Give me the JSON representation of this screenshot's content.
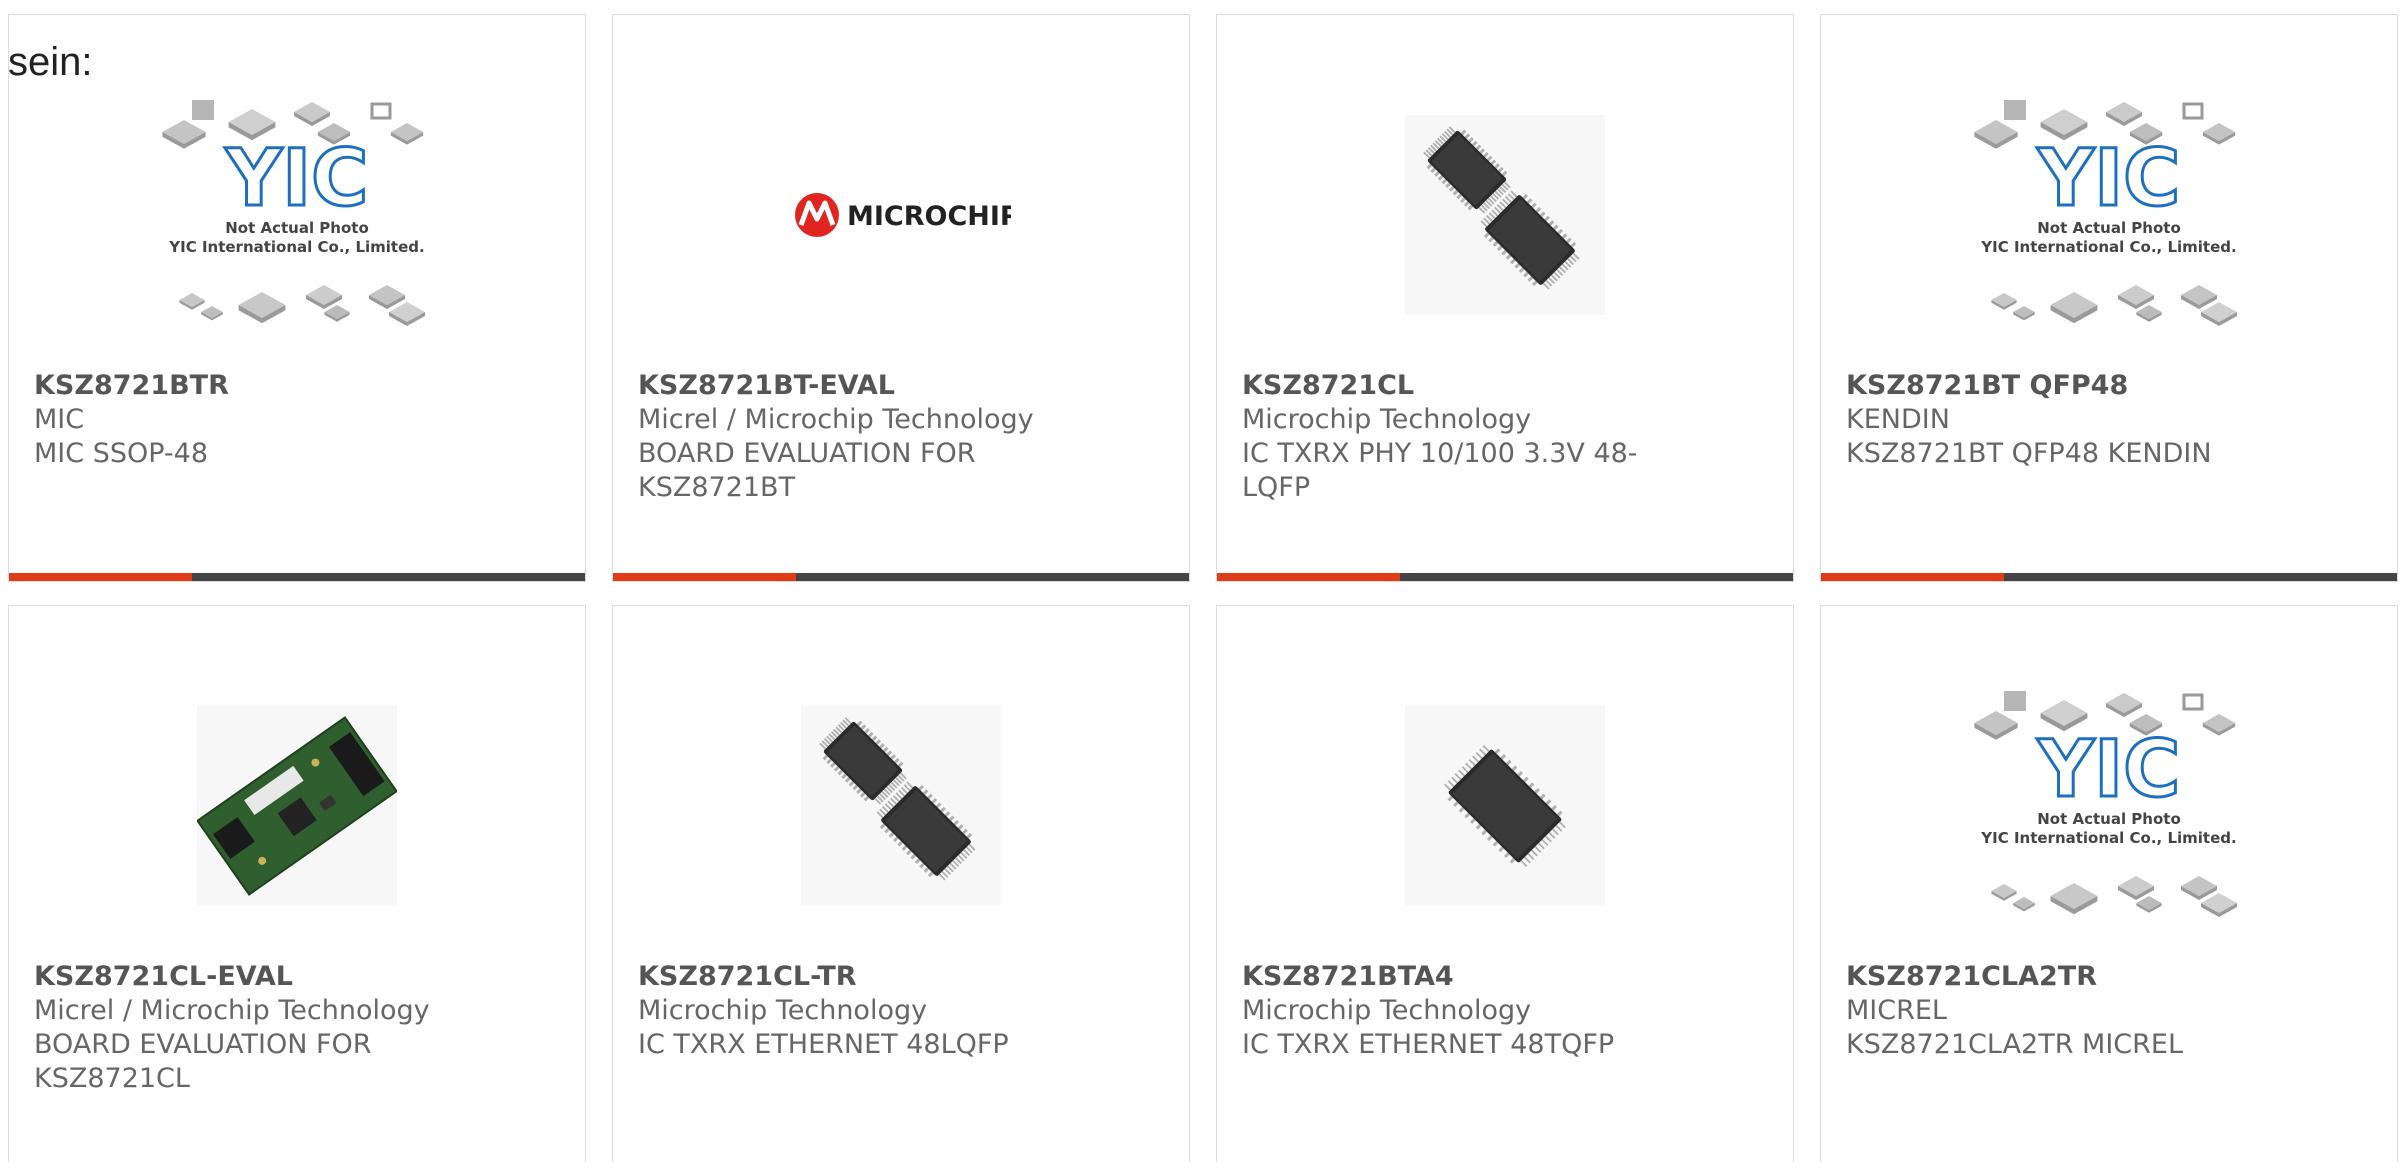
{
  "intro_text": "sein:",
  "placeholder": {
    "caption_line1": "Not Actual Photo",
    "caption_line2": "YIC International Co., Limited.",
    "logo": "YIC"
  },
  "microchip_logo_text": "MICROCHIP",
  "colors": {
    "accent": "#e03c18",
    "bar_dark": "#444444",
    "text": "#666666"
  },
  "cards": [
    {
      "part_number": "KSZ8721BTR",
      "manufacturer": "MIC",
      "description_lines": [
        "MIC SSOP-48"
      ],
      "image": "yic-placeholder-image",
      "has_bar": true
    },
    {
      "part_number": "KSZ8721BT-EVAL",
      "manufacturer": "Micrel / Microchip Technology",
      "description_lines": [
        "BOARD EVALUATION FOR",
        "KSZ8721BT"
      ],
      "image": "microchip-logo-image",
      "has_bar": true
    },
    {
      "part_number": "KSZ8721CL",
      "manufacturer": "Microchip Technology",
      "description_lines": [
        "IC TXRX PHY 10/100 3.3V 48-",
        "LQFP"
      ],
      "image": "lqfp-chips-image",
      "has_bar": true
    },
    {
      "part_number": "KSZ8721BT QFP48",
      "manufacturer": "KENDIN",
      "description_lines": [
        "KSZ8721BT QFP48 KENDIN"
      ],
      "image": "yic-placeholder-image",
      "has_bar": true
    },
    {
      "part_number": "KSZ8721CL-EVAL",
      "manufacturer": "Micrel / Microchip Technology",
      "description_lines": [
        "BOARD EVALUATION FOR",
        "KSZ8721CL"
      ],
      "image": "eval-board-image",
      "has_bar": false
    },
    {
      "part_number": "KSZ8721CL-TR",
      "manufacturer": "Microchip Technology",
      "description_lines": [
        "IC TXRX ETHERNET 48LQFP"
      ],
      "image": "lqfp-chips-image",
      "has_bar": false
    },
    {
      "part_number": "KSZ8721BTA4",
      "manufacturer": "Microchip Technology",
      "description_lines": [
        "IC TXRX ETHERNET 48TQFP"
      ],
      "image": "tqfp-chip-image",
      "has_bar": false
    },
    {
      "part_number": "KSZ8721CLA2TR",
      "manufacturer": "MICREL",
      "description_lines": [
        "KSZ8721CLA2TR MICREL"
      ],
      "image": "yic-placeholder-image",
      "has_bar": false
    }
  ]
}
